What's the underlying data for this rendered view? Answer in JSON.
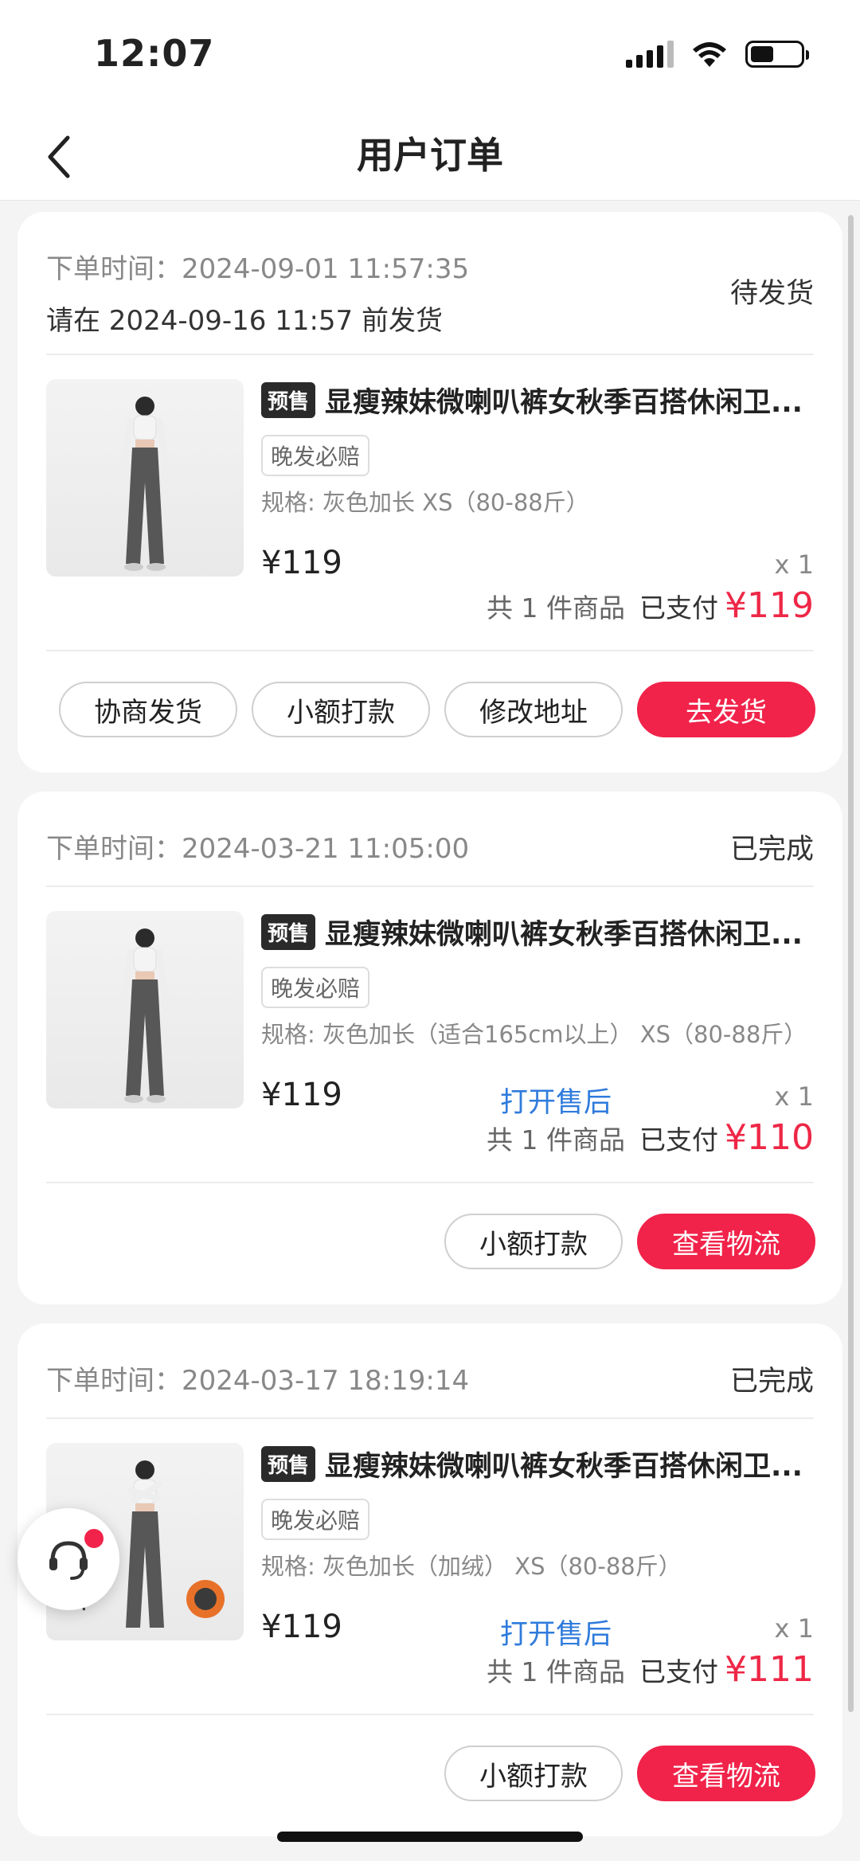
{
  "status": {
    "time": "12:07"
  },
  "nav": {
    "title": "用户订单",
    "back_icon": "chevron-left-icon"
  },
  "orders": [
    {
      "time_label": "下单时间：",
      "time": "2024-09-01 11:57:35",
      "ship_note": "请在 2024-09-16 11:57 前发货",
      "status": "待发货",
      "presale": "预售",
      "title": "显瘦辣妹微喇叭裤女秋季百搭休闲卫...",
      "tag": "晚发必赔",
      "spec": "规格: 灰色加长 XS（80-88斤）",
      "price": "¥119",
      "aftersale": "",
      "qty": "x 1",
      "count": "共 1 件商品",
      "paid_label": "已支付",
      "paid": "¥119",
      "buttons": [
        "协商发货",
        "小额打款",
        "修改地址",
        "去发货"
      ]
    },
    {
      "time_label": "下单时间：",
      "time": "2024-03-21 11:05:00",
      "status": "已完成",
      "presale": "预售",
      "title": "显瘦辣妹微喇叭裤女秋季百搭休闲卫...",
      "tag": "晚发必赔",
      "spec": "规格: 灰色加长（适合165cm以上） XS（80-88斤）",
      "price": "¥119",
      "aftersale": "打开售后",
      "qty": "x 1",
      "count": "共 1 件商品",
      "paid_label": "已支付",
      "paid": "¥110",
      "buttons": [
        "小额打款",
        "查看物流"
      ]
    },
    {
      "time_label": "下单时间：",
      "time": "2024-03-17 18:19:14",
      "status": "已完成",
      "presale": "预售",
      "title": "显瘦辣妹微喇叭裤女秋季百搭休闲卫...",
      "tag": "晚发必赔",
      "spec": "规格: 灰色加长（加绒） XS（80-88斤）",
      "price": "¥119",
      "aftersale": "打开售后",
      "qty": "x 1",
      "count": "共 1 件商品",
      "paid_label": "已支付",
      "paid": "¥111",
      "buttons": [
        "小额打款",
        "查看物流"
      ]
    }
  ],
  "float_button": {
    "icon": "customer-service-icon"
  },
  "colors": {
    "accent": "#f1234a",
    "link": "#2f7bdc"
  }
}
